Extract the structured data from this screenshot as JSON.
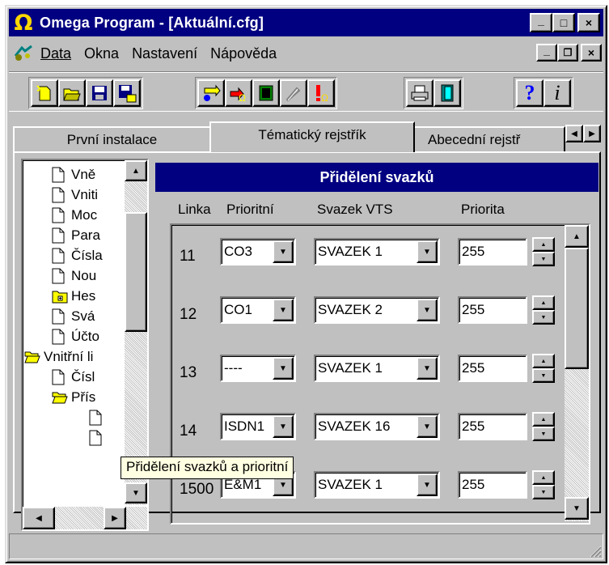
{
  "window": {
    "title": "Omega Program - [Aktuální.cfg]",
    "app_icon": "omega-icon",
    "app_icon_glyph": "Ω",
    "controls": {
      "minimize": "_",
      "maximize": "□",
      "close": "×"
    }
  },
  "menu": {
    "items": [
      {
        "label": "Data",
        "access_key": "D"
      },
      {
        "label": "Okna",
        "access_key": "O"
      },
      {
        "label": "Nastavení",
        "access_key": "s"
      },
      {
        "label": "Nápověda",
        "access_key": "N"
      }
    ],
    "mdi_controls": {
      "minimize": "_",
      "restore": "❐",
      "close": "×"
    }
  },
  "toolbar": {
    "buttons": [
      "new-file-icon",
      "open-folder-icon",
      "save-icon",
      "save-as-icon",
      "connect-icon",
      "send-icon",
      "chip-icon",
      "disabled-probe-icon",
      "alert-icon",
      "print-icon",
      "exit-door-icon",
      "help-icon",
      "info-icon"
    ]
  },
  "tabs": [
    {
      "label": "První instalace"
    },
    {
      "label": "Tématický rejstřík",
      "active": true
    },
    {
      "label": "Abecední rejstř"
    }
  ],
  "tree": {
    "items": [
      {
        "label": "Vně",
        "icon": "document-icon"
      },
      {
        "label": "Vniti",
        "icon": "document-icon"
      },
      {
        "label": "Moc",
        "icon": "document-icon"
      },
      {
        "label": "Para",
        "icon": "document-icon"
      },
      {
        "label": "Čísla",
        "icon": "document-icon"
      },
      {
        "label": "Nou",
        "icon": "document-icon"
      },
      {
        "label": "Hes",
        "icon": "folder-closed-icon"
      },
      {
        "label": "Svá",
        "icon": "document-icon"
      },
      {
        "label": "Účto",
        "icon": "document-icon"
      },
      {
        "label": "Vnitřní li",
        "icon": "folder-open-icon"
      },
      {
        "label": "Čísl",
        "icon": "document-icon"
      },
      {
        "label": "Přís",
        "icon": "folder-open-icon"
      },
      {
        "label": "",
        "icon": "document-icon"
      },
      {
        "label": "",
        "icon": "document-icon"
      }
    ],
    "tooltip": "Přidělení svazků a prioritní"
  },
  "panel": {
    "title": "Přidělení svazků",
    "columns": {
      "linka": "Linka",
      "prioritni": "Prioritní",
      "svazek": "Svazek VTS",
      "priorita": "Priorita"
    },
    "rows": [
      {
        "linka": "11",
        "prioritni": "CO3",
        "svazek": "SVAZEK 1",
        "priorita": "255"
      },
      {
        "linka": "12",
        "prioritni": "CO1",
        "svazek": "SVAZEK 2",
        "priorita": "255"
      },
      {
        "linka": "13",
        "prioritni": "----",
        "svazek": "SVAZEK 1",
        "priorita": "255"
      },
      {
        "linka": "14",
        "prioritni": "ISDN1",
        "svazek": "SVAZEK 16",
        "priorita": "255"
      },
      {
        "linka": "1500",
        "prioritni": "E&M1",
        "svazek": "SVAZEK 1",
        "priorita": "255"
      }
    ]
  }
}
